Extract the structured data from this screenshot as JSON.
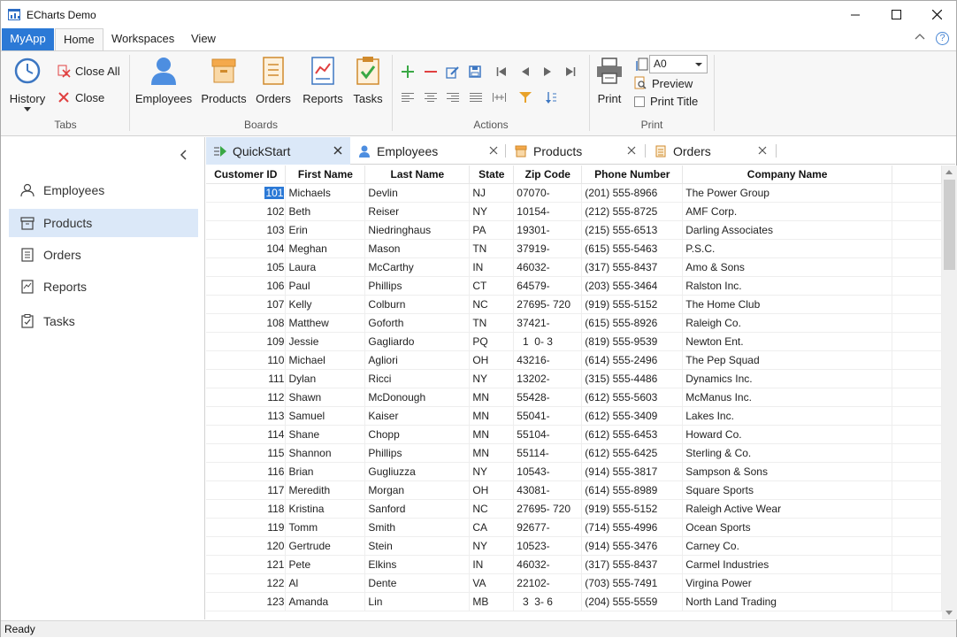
{
  "window": {
    "title": "ECharts Demo"
  },
  "ribbon": {
    "app_tab": "MyApp",
    "tabs": [
      "Home",
      "Workspaces",
      "View"
    ],
    "groups": {
      "tabs": {
        "label": "Tabs",
        "history": "History",
        "close_all": "Close All",
        "close": "Close"
      },
      "boards": {
        "label": "Boards",
        "items": [
          "Employees",
          "Products",
          "Orders",
          "Reports",
          "Tasks"
        ]
      },
      "actions": {
        "label": "Actions"
      },
      "print": {
        "label": "Print",
        "print_button": "Print",
        "paper_size": "A0",
        "preview": "Preview",
        "print_title": "Print Title"
      }
    },
    "help": "?"
  },
  "sidebar": {
    "items": [
      "Employees",
      "Products",
      "Orders",
      "Reports",
      "Tasks"
    ],
    "active": "Products"
  },
  "doc_tabs": [
    "QuickStart",
    "Employees",
    "Products",
    "Orders"
  ],
  "grid": {
    "columns": [
      "Customer ID",
      "First Name",
      "Last Name",
      "State",
      "Zip Code",
      "Phone Number",
      "Company Name"
    ],
    "rows": [
      [
        "101",
        "Michaels",
        "Devlin",
        "NJ",
        "07070-",
        "(201) 555-8966",
        "The Power Group"
      ],
      [
        "102",
        "Beth",
        "Reiser",
        "NY",
        "10154-",
        "(212) 555-8725",
        "AMF Corp."
      ],
      [
        "103",
        "Erin",
        "Niedringhaus",
        "PA",
        "19301-",
        "(215) 555-6513",
        "Darling Associates"
      ],
      [
        "104",
        "Meghan",
        "Mason",
        "TN",
        "37919-",
        "(615) 555-5463",
        "P.S.C."
      ],
      [
        "105",
        "Laura",
        "McCarthy",
        "IN",
        "46032-",
        "(317) 555-8437",
        "Amo & Sons"
      ],
      [
        "106",
        "Paul",
        "Phillips",
        "CT",
        "64579-",
        "(203) 555-3464",
        "Ralston Inc."
      ],
      [
        "107",
        "Kelly",
        "Colburn",
        "NC",
        "27695- 720",
        "(919) 555-5152",
        "The Home Club"
      ],
      [
        "108",
        "Matthew",
        "Goforth",
        "TN",
        "37421-",
        "(615) 555-8926",
        "Raleigh Co."
      ],
      [
        "109",
        "Jessie",
        "Gagliardo",
        "PQ",
        "  1  0- 3",
        "(819) 555-9539",
        "Newton Ent."
      ],
      [
        "110",
        "Michael",
        "Agliori",
        "OH",
        "43216-",
        "(614) 555-2496",
        "The Pep Squad"
      ],
      [
        "111",
        "Dylan",
        "Ricci",
        "NY",
        "13202-",
        "(315) 555-4486",
        "Dynamics Inc."
      ],
      [
        "112",
        "Shawn",
        "McDonough",
        "MN",
        "55428-",
        "(612) 555-5603",
        "McManus Inc."
      ],
      [
        "113",
        "Samuel",
        "Kaiser",
        "MN",
        "55041-",
        "(612) 555-3409",
        "Lakes Inc."
      ],
      [
        "114",
        "Shane",
        "Chopp",
        "MN",
        "55104-",
        "(612) 555-6453",
        "Howard Co."
      ],
      [
        "115",
        "Shannon",
        "Phillips",
        "MN",
        "55114-",
        "(612) 555-6425",
        "Sterling & Co."
      ],
      [
        "116",
        "Brian",
        "Gugliuzza",
        "NY",
        "10543-",
        "(914) 555-3817",
        "Sampson & Sons"
      ],
      [
        "117",
        "Meredith",
        "Morgan",
        "OH",
        "43081-",
        "(614) 555-8989",
        "Square Sports"
      ],
      [
        "118",
        "Kristina",
        "Sanford",
        "NC",
        "27695- 720",
        "(919) 555-5152",
        "Raleigh Active Wear"
      ],
      [
        "119",
        "Tomm",
        "Smith",
        "CA",
        "92677-",
        "(714) 555-4996",
        "Ocean Sports"
      ],
      [
        "120",
        "Gertrude",
        "Stein",
        "NY",
        "10523-",
        "(914) 555-3476",
        "Carney Co."
      ],
      [
        "121",
        "Pete",
        "Elkins",
        "IN",
        "46032-",
        "(317) 555-8437",
        "Carmel Industries"
      ],
      [
        "122",
        "Al",
        "Dente",
        "VA",
        "22102-",
        "(703) 555-7491",
        "Virgina Power"
      ],
      [
        "123",
        "Amanda",
        "Lin",
        "MB",
        "  3  3- 6",
        "(204) 555-5559",
        "North Land Trading"
      ]
    ]
  },
  "status": "Ready"
}
